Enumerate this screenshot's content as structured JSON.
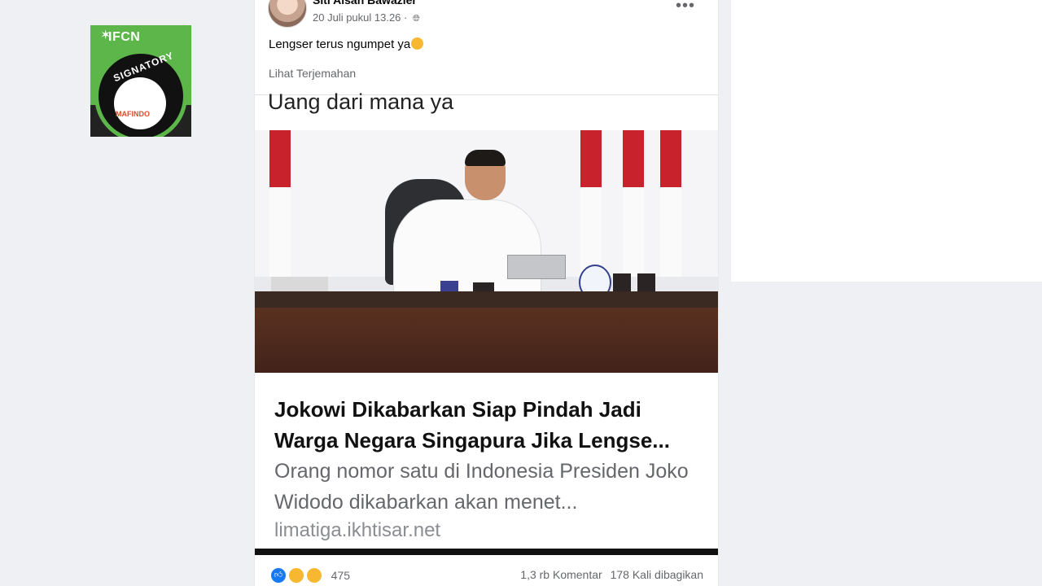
{
  "badge": {
    "ifcn": "IFCN",
    "ring_text": "SIGNATORY",
    "inner_text": "MAFINDO"
  },
  "post": {
    "author": "Siti Aisah Bawazier",
    "timestamp": "20 Juli pukul 13.26 ·",
    "more": "•••",
    "caption": "Lengser terus ngumpet ya",
    "translate": "Lihat Terjemahan",
    "overlay_text": "Uang dari mana ya"
  },
  "link_preview": {
    "title": "Jokowi Dikabarkan Siap Pindah Jadi Warga Negara Singapura Jika Lengse...",
    "description": "Orang nomor satu di Indonesia Presiden Joko Widodo dikabarkan akan menet...",
    "domain": "limatiga.ikhtisar.net"
  },
  "reactions": {
    "icons": [
      "like-icon",
      "haha-icon",
      "wow-icon"
    ],
    "count": "475",
    "comments": "1,3 rb Komentar",
    "shares": "178 Kali dibagikan"
  }
}
